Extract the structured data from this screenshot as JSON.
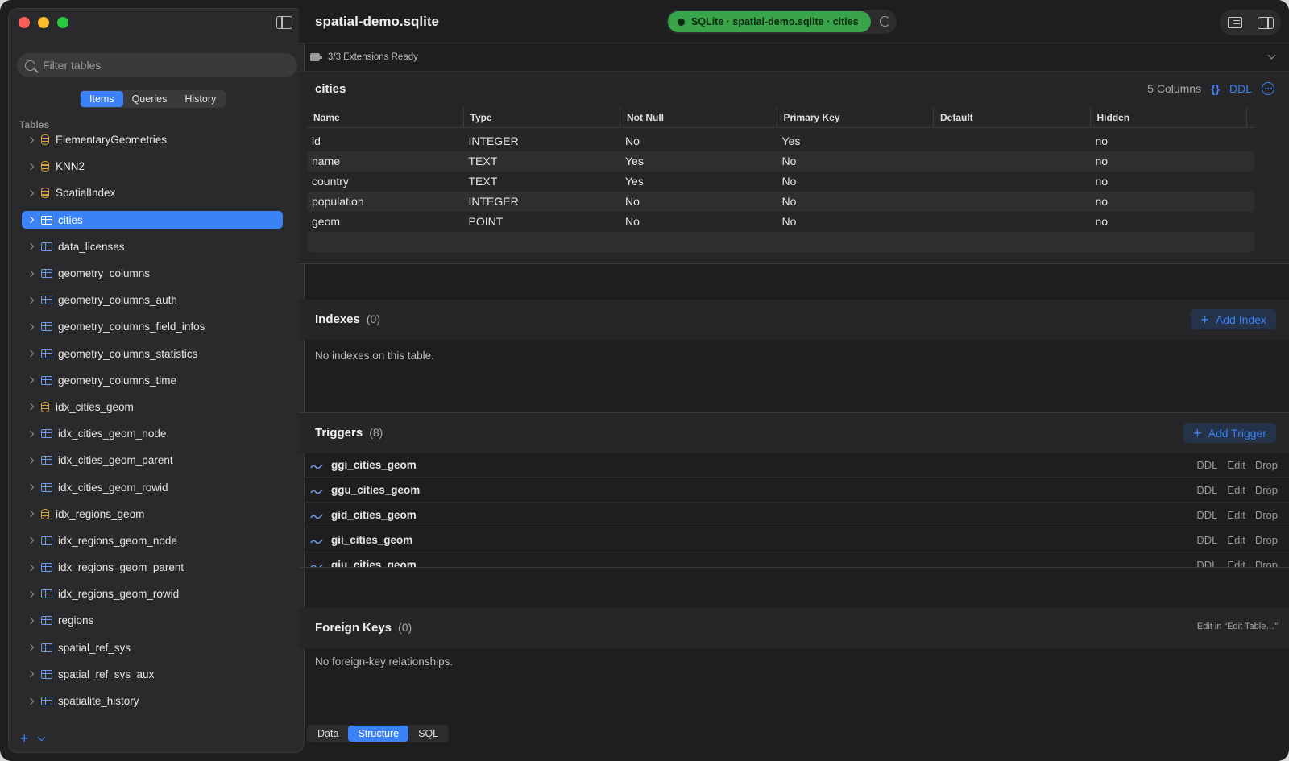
{
  "sidebar": {
    "search_placeholder": "Filter tables",
    "tabs": [
      {
        "label": "Items",
        "active": true
      },
      {
        "label": "Queries",
        "active": false
      },
      {
        "label": "History",
        "active": false
      }
    ],
    "section_label": "Tables",
    "items": [
      {
        "label": "ElementaryGeometries",
        "icon": "database-icon"
      },
      {
        "label": "KNN2",
        "icon": "database-icon"
      },
      {
        "label": "SpatialIndex",
        "icon": "database-icon"
      },
      {
        "label": "cities",
        "icon": "table-icon",
        "selected": true
      },
      {
        "label": "data_licenses",
        "icon": "table-icon"
      },
      {
        "label": "geometry_columns",
        "icon": "table-icon"
      },
      {
        "label": "geometry_columns_auth",
        "icon": "table-icon"
      },
      {
        "label": "geometry_columns_field_infos",
        "icon": "table-icon"
      },
      {
        "label": "geometry_columns_statistics",
        "icon": "table-icon"
      },
      {
        "label": "geometry_columns_time",
        "icon": "table-icon"
      },
      {
        "label": "idx_cities_geom",
        "icon": "database-icon"
      },
      {
        "label": "idx_cities_geom_node",
        "icon": "table-icon"
      },
      {
        "label": "idx_cities_geom_parent",
        "icon": "table-icon"
      },
      {
        "label": "idx_cities_geom_rowid",
        "icon": "table-icon"
      },
      {
        "label": "idx_regions_geom",
        "icon": "database-icon"
      },
      {
        "label": "idx_regions_geom_node",
        "icon": "table-icon"
      },
      {
        "label": "idx_regions_geom_parent",
        "icon": "table-icon"
      },
      {
        "label": "idx_regions_geom_rowid",
        "icon": "table-icon"
      },
      {
        "label": "regions",
        "icon": "table-icon"
      },
      {
        "label": "spatial_ref_sys",
        "icon": "table-icon"
      },
      {
        "label": "spatial_ref_sys_aux",
        "icon": "table-icon"
      },
      {
        "label": "spatialite_history",
        "icon": "table-icon"
      }
    ]
  },
  "toolbar": {
    "title": "spatial-demo.sqlite",
    "connection": "SQLite · spatial-demo.sqlite · cities"
  },
  "extensions": {
    "status": "3/3 Extensions Ready"
  },
  "columns": {
    "title": "cities",
    "count_label": "5 Columns",
    "braces": "{}",
    "ddl_label": "DDL",
    "headers": [
      "Name",
      "Type",
      "Not Null",
      "Primary Key",
      "Default",
      "Hidden"
    ],
    "rows": [
      [
        "id",
        "INTEGER",
        "No",
        "Yes",
        "",
        "no"
      ],
      [
        "name",
        "TEXT",
        "Yes",
        "No",
        "",
        "no"
      ],
      [
        "country",
        "TEXT",
        "Yes",
        "No",
        "",
        "no"
      ],
      [
        "population",
        "INTEGER",
        "No",
        "No",
        "",
        "no"
      ],
      [
        "geom",
        "POINT",
        "No",
        "No",
        "",
        "no"
      ]
    ]
  },
  "indexes": {
    "title": "Indexes",
    "count": "(0)",
    "add_label": "Add Index",
    "empty": "No indexes on this table."
  },
  "triggers": {
    "title": "Triggers",
    "count": "(8)",
    "add_label": "Add Trigger",
    "items": [
      "ggi_cities_geom",
      "ggu_cities_geom",
      "gid_cities_geom",
      "gii_cities_geom",
      "giu_cities_geom"
    ],
    "actions": [
      "DDL",
      "Edit",
      "Drop"
    ]
  },
  "foreign_keys": {
    "title": "Foreign Keys",
    "count": "(0)",
    "edit_label": "Edit in “Edit Table…”",
    "empty": "No foreign-key relationships."
  },
  "bottom_tabs": [
    {
      "label": "Data",
      "active": false
    },
    {
      "label": "Structure",
      "active": true
    },
    {
      "label": "SQL",
      "active": false
    }
  ]
}
